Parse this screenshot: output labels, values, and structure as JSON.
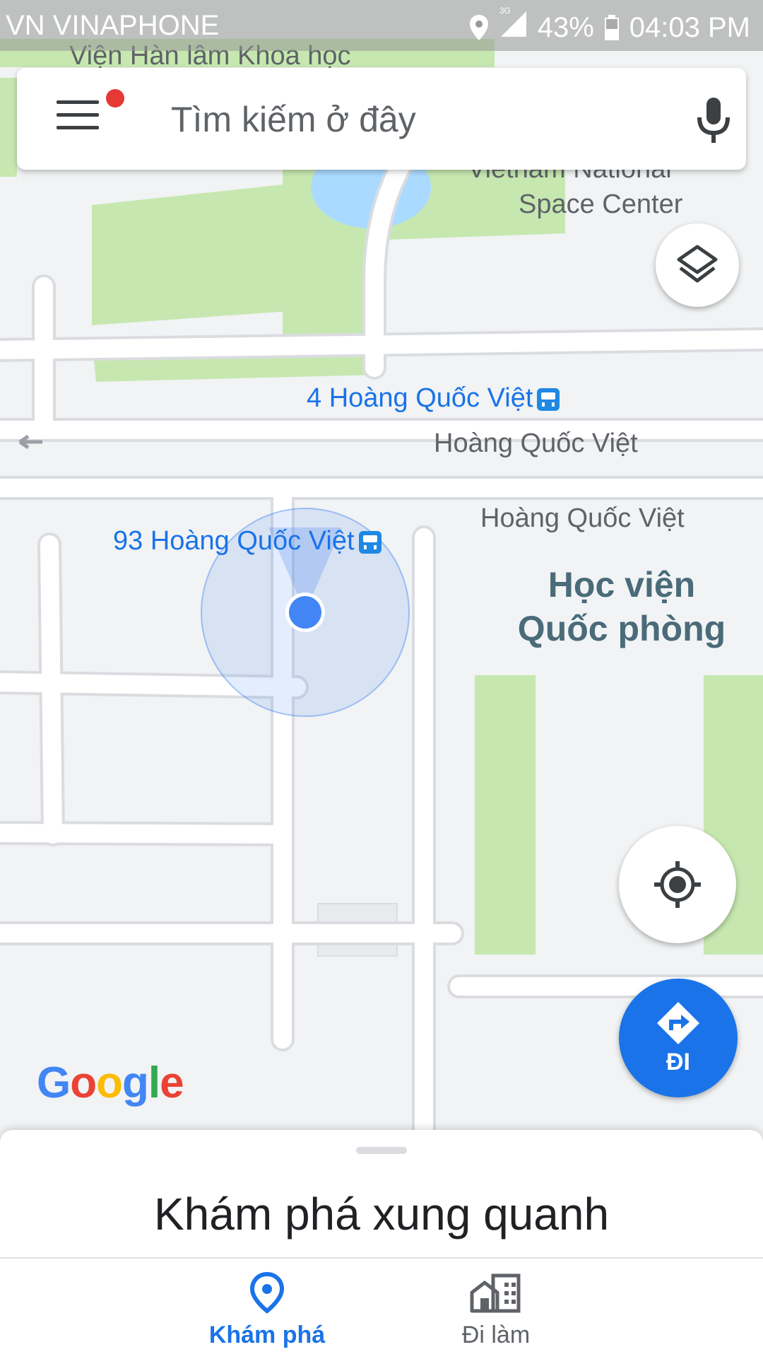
{
  "status_bar": {
    "carrier": "VN VINAPHONE",
    "network": "3G",
    "battery": "43%",
    "time": "04:03 PM"
  },
  "search": {
    "placeholder": "Tìm kiếm ở đây"
  },
  "map": {
    "labels": {
      "institute": "Viện Hàn lâm Khoa học",
      "space_center_line1": "Vietnam National",
      "space_center_line2": "Space Center",
      "road_1": "Hoàng Quốc Việt",
      "road_2": "Hoàng Quốc Việt"
    },
    "transit": {
      "stop_1": "4 Hoàng Quốc Việt",
      "stop_2": "93 Hoàng Quốc Việt"
    },
    "poi": {
      "line1": "Học viện",
      "line2": "Quốc phòng"
    },
    "logo": "Google",
    "colors": {
      "park": "#c6e8b0",
      "water": "#aadaff",
      "road": "#ffffff",
      "location": "#4285f4"
    }
  },
  "fabs": {
    "layers_icon": "layers-icon",
    "locate_icon": "my-location-icon",
    "go_label": "ĐI"
  },
  "sheet": {
    "title": "Khám phá xung quanh"
  },
  "nav": {
    "explore": "Khám phá",
    "commute": "Đi làm"
  }
}
